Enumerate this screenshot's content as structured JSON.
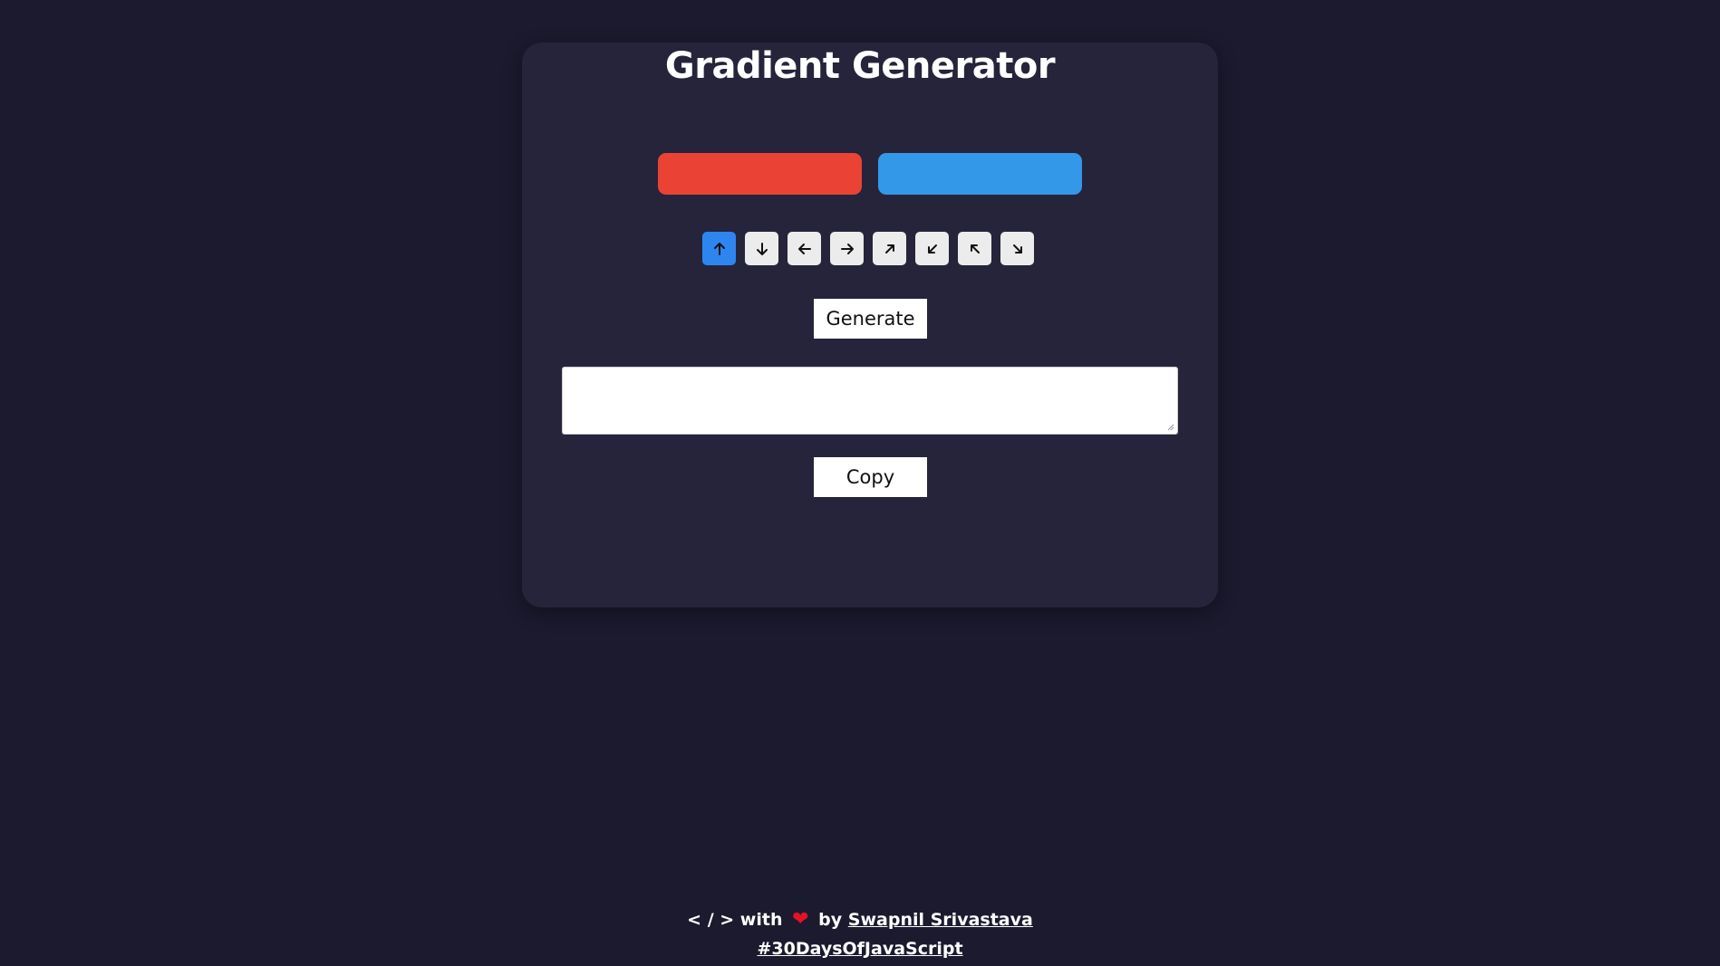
{
  "title": "Gradient Generator",
  "colors": {
    "background": "#1b1a2e",
    "card": "#25243b",
    "swatch_1": "#ea4335",
    "swatch_2": "#3498e8",
    "accent": "#2d86f0"
  },
  "color_pickers": [
    {
      "value": "#ea4335"
    },
    {
      "value": "#3498e8"
    }
  ],
  "directions": [
    {
      "icon": "arrow-up-icon",
      "active": true
    },
    {
      "icon": "arrow-down-icon",
      "active": false
    },
    {
      "icon": "arrow-left-icon",
      "active": false
    },
    {
      "icon": "arrow-right-icon",
      "active": false
    },
    {
      "icon": "arrow-up-right-icon",
      "active": false
    },
    {
      "icon": "arrow-down-left-icon",
      "active": false
    },
    {
      "icon": "arrow-up-left-icon",
      "active": false
    },
    {
      "icon": "arrow-down-right-icon",
      "active": false
    }
  ],
  "buttons": {
    "generate": "Generate",
    "copy": "Copy"
  },
  "output": {
    "value": ""
  },
  "footer": {
    "prefix": "< / > with",
    "heart_icon": "heart-icon",
    "by": "by",
    "author": "Swapnil Srivastava",
    "hashtag": "#30DaysOfJavaScript"
  }
}
